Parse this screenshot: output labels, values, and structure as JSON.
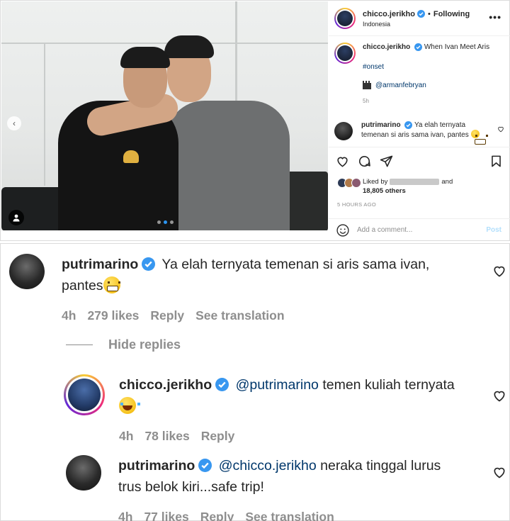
{
  "post": {
    "header": {
      "username": "chicco.jerikho",
      "separator": "•",
      "follow_status": "Following",
      "location": "Indonesia",
      "more_icon": "more-horizontal-icon"
    },
    "caption": {
      "username": "chicco.jerikho",
      "text": "When Ivan Meet Aris",
      "hashtag": "#onset",
      "mention": "@armanfebryan",
      "time": "5h"
    },
    "top_comment": {
      "username": "putrimarino",
      "text": "Ya elah ternyata temenan si aris sama ivan, pantes"
    },
    "likes": {
      "prefix": "Liked by",
      "and": "and",
      "others": "18,805 others"
    },
    "posted_ago": "5 HOURS AGO",
    "add_comment": {
      "placeholder": "Add a comment...",
      "post_label": "Post"
    }
  },
  "zoom": {
    "comment1": {
      "username": "putrimarino",
      "text_line1": "Ya elah ternyata temenan si aris sama ivan,",
      "text_line2": "pantes",
      "time": "4h",
      "likes": "279 likes",
      "reply": "Reply",
      "translate": "See translation"
    },
    "hide_replies": "Hide replies",
    "reply1": {
      "username": "chicco.jerikho",
      "mention": "@putrimarino",
      "text": "temen kuliah ternyata",
      "time": "4h",
      "likes": "78 likes",
      "reply": "Reply"
    },
    "reply2": {
      "username": "putrimarino",
      "mention": "@chicco.jerikho",
      "text_line1": "neraka tinggal lurus",
      "text_line2": "trus belok kiri...safe trip!",
      "time": "4h",
      "likes": "77 likes",
      "reply": "Reply",
      "translate": "See translation"
    }
  },
  "colors": {
    "verified": "#3897f0",
    "link": "#00376b",
    "muted": "#8e8e8e",
    "post_button": "#b2dffc"
  }
}
